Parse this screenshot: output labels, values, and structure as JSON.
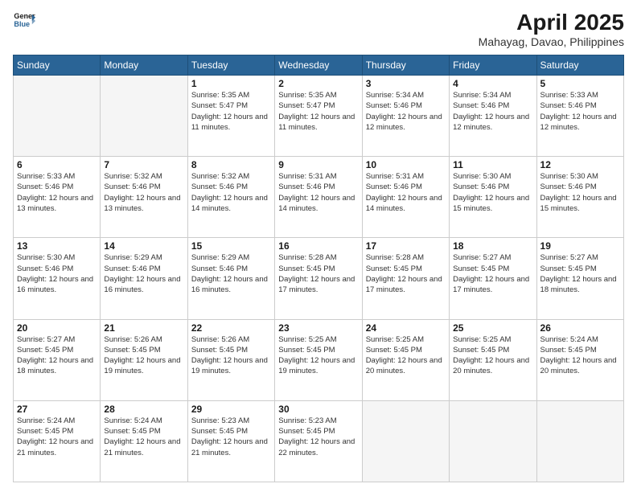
{
  "header": {
    "logo_line1": "General",
    "logo_line2": "Blue",
    "title": "April 2025",
    "subtitle": "Mahayag, Davao, Philippines"
  },
  "weekdays": [
    "Sunday",
    "Monday",
    "Tuesday",
    "Wednesday",
    "Thursday",
    "Friday",
    "Saturday"
  ],
  "weeks": [
    [
      {
        "day": "",
        "info": ""
      },
      {
        "day": "",
        "info": ""
      },
      {
        "day": "1",
        "info": "Sunrise: 5:35 AM\nSunset: 5:47 PM\nDaylight: 12 hours and 11 minutes."
      },
      {
        "day": "2",
        "info": "Sunrise: 5:35 AM\nSunset: 5:47 PM\nDaylight: 12 hours and 11 minutes."
      },
      {
        "day": "3",
        "info": "Sunrise: 5:34 AM\nSunset: 5:46 PM\nDaylight: 12 hours and 12 minutes."
      },
      {
        "day": "4",
        "info": "Sunrise: 5:34 AM\nSunset: 5:46 PM\nDaylight: 12 hours and 12 minutes."
      },
      {
        "day": "5",
        "info": "Sunrise: 5:33 AM\nSunset: 5:46 PM\nDaylight: 12 hours and 12 minutes."
      }
    ],
    [
      {
        "day": "6",
        "info": "Sunrise: 5:33 AM\nSunset: 5:46 PM\nDaylight: 12 hours and 13 minutes."
      },
      {
        "day": "7",
        "info": "Sunrise: 5:32 AM\nSunset: 5:46 PM\nDaylight: 12 hours and 13 minutes."
      },
      {
        "day": "8",
        "info": "Sunrise: 5:32 AM\nSunset: 5:46 PM\nDaylight: 12 hours and 14 minutes."
      },
      {
        "day": "9",
        "info": "Sunrise: 5:31 AM\nSunset: 5:46 PM\nDaylight: 12 hours and 14 minutes."
      },
      {
        "day": "10",
        "info": "Sunrise: 5:31 AM\nSunset: 5:46 PM\nDaylight: 12 hours and 14 minutes."
      },
      {
        "day": "11",
        "info": "Sunrise: 5:30 AM\nSunset: 5:46 PM\nDaylight: 12 hours and 15 minutes."
      },
      {
        "day": "12",
        "info": "Sunrise: 5:30 AM\nSunset: 5:46 PM\nDaylight: 12 hours and 15 minutes."
      }
    ],
    [
      {
        "day": "13",
        "info": "Sunrise: 5:30 AM\nSunset: 5:46 PM\nDaylight: 12 hours and 16 minutes."
      },
      {
        "day": "14",
        "info": "Sunrise: 5:29 AM\nSunset: 5:46 PM\nDaylight: 12 hours and 16 minutes."
      },
      {
        "day": "15",
        "info": "Sunrise: 5:29 AM\nSunset: 5:46 PM\nDaylight: 12 hours and 16 minutes."
      },
      {
        "day": "16",
        "info": "Sunrise: 5:28 AM\nSunset: 5:45 PM\nDaylight: 12 hours and 17 minutes."
      },
      {
        "day": "17",
        "info": "Sunrise: 5:28 AM\nSunset: 5:45 PM\nDaylight: 12 hours and 17 minutes."
      },
      {
        "day": "18",
        "info": "Sunrise: 5:27 AM\nSunset: 5:45 PM\nDaylight: 12 hours and 17 minutes."
      },
      {
        "day": "19",
        "info": "Sunrise: 5:27 AM\nSunset: 5:45 PM\nDaylight: 12 hours and 18 minutes."
      }
    ],
    [
      {
        "day": "20",
        "info": "Sunrise: 5:27 AM\nSunset: 5:45 PM\nDaylight: 12 hours and 18 minutes."
      },
      {
        "day": "21",
        "info": "Sunrise: 5:26 AM\nSunset: 5:45 PM\nDaylight: 12 hours and 19 minutes."
      },
      {
        "day": "22",
        "info": "Sunrise: 5:26 AM\nSunset: 5:45 PM\nDaylight: 12 hours and 19 minutes."
      },
      {
        "day": "23",
        "info": "Sunrise: 5:25 AM\nSunset: 5:45 PM\nDaylight: 12 hours and 19 minutes."
      },
      {
        "day": "24",
        "info": "Sunrise: 5:25 AM\nSunset: 5:45 PM\nDaylight: 12 hours and 20 minutes."
      },
      {
        "day": "25",
        "info": "Sunrise: 5:25 AM\nSunset: 5:45 PM\nDaylight: 12 hours and 20 minutes."
      },
      {
        "day": "26",
        "info": "Sunrise: 5:24 AM\nSunset: 5:45 PM\nDaylight: 12 hours and 20 minutes."
      }
    ],
    [
      {
        "day": "27",
        "info": "Sunrise: 5:24 AM\nSunset: 5:45 PM\nDaylight: 12 hours and 21 minutes."
      },
      {
        "day": "28",
        "info": "Sunrise: 5:24 AM\nSunset: 5:45 PM\nDaylight: 12 hours and 21 minutes."
      },
      {
        "day": "29",
        "info": "Sunrise: 5:23 AM\nSunset: 5:45 PM\nDaylight: 12 hours and 21 minutes."
      },
      {
        "day": "30",
        "info": "Sunrise: 5:23 AM\nSunset: 5:45 PM\nDaylight: 12 hours and 22 minutes."
      },
      {
        "day": "",
        "info": ""
      },
      {
        "day": "",
        "info": ""
      },
      {
        "day": "",
        "info": ""
      }
    ]
  ]
}
